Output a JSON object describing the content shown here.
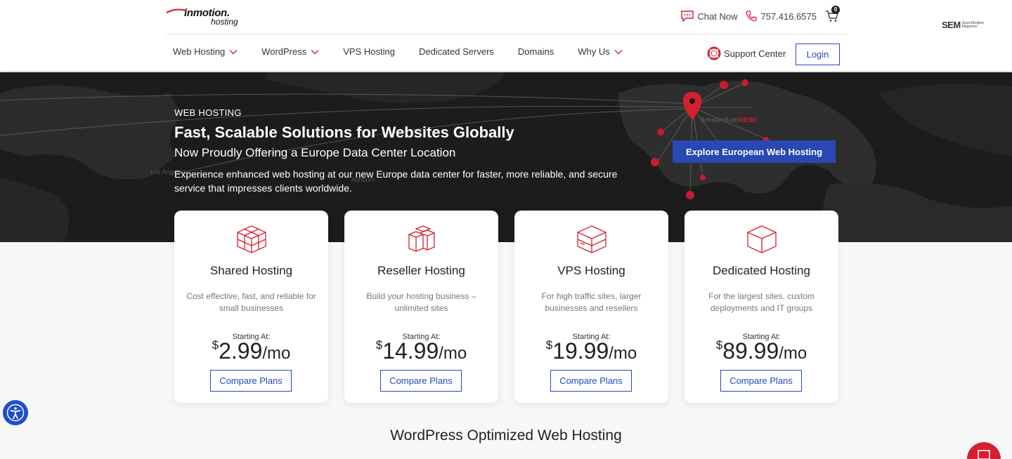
{
  "header": {
    "logo_brand": "inmotion.",
    "logo_sub": "hosting",
    "chat_label": "Chat Now",
    "phone": "757.416.6575",
    "cart_count": "0",
    "sem_main": "SEM",
    "sem_sub": "SearchEngine Magazine"
  },
  "nav": {
    "items": [
      {
        "label": "Web Hosting",
        "dropdown": true
      },
      {
        "label": "WordPress",
        "dropdown": true
      },
      {
        "label": "VPS Hosting",
        "dropdown": false
      },
      {
        "label": "Dedicated Servers",
        "dropdown": false
      },
      {
        "label": "Domains",
        "dropdown": false
      },
      {
        "label": "Why Us",
        "dropdown": true
      }
    ],
    "support_label": "Support Center",
    "login_label": "Login"
  },
  "hero": {
    "label": "WEB HOSTING",
    "title": "Fast, Scalable Solutions for Websites Globally",
    "subtitle": "Now Proudly Offering a Europe Data Center Location",
    "description": "Experience enhanced web hosting at our new Europe data center for faster, more reliable, and secure service that impresses clients worldwide.",
    "cta_label": "Explore European Web Hosting",
    "map_city_la": "Los Angeles",
    "map_city_ashburn": "Ashburn",
    "map_city_amsterdam": "Amsterdam",
    "map_new_badge": "NEW!"
  },
  "cards": [
    {
      "title": "Shared Hosting",
      "desc": "Cost effective, fast, and reliable for small businesses",
      "starting": "Starting At:",
      "currency": "$",
      "price": "2.99",
      "per": "/mo",
      "button": "Compare Plans"
    },
    {
      "title": "Reseller Hosting",
      "desc": "Build your hosting business – unlimited sites",
      "starting": "Starting At:",
      "currency": "$",
      "price": "14.99",
      "per": "/mo",
      "button": "Compare Plans"
    },
    {
      "title": "VPS Hosting",
      "desc": "For high traffic sites, larger businesses and resellers",
      "starting": "Starting At:",
      "currency": "$",
      "price": "19.99",
      "per": "/mo",
      "button": "Compare Plans"
    },
    {
      "title": "Dedicated Hosting",
      "desc": "For the largest sites, custom deployments and IT groups",
      "starting": "Starting At:",
      "currency": "$",
      "price": "89.99",
      "per": "/mo",
      "button": "Compare Plans"
    }
  ],
  "section_title": "WordPress Optimized Web Hosting",
  "colors": {
    "accent_red": "#d3202f",
    "brand_blue": "#2948b8",
    "hero_bg": "#1c1c1c"
  }
}
